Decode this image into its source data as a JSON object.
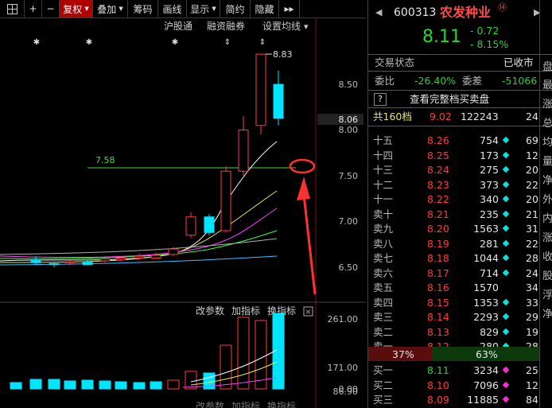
{
  "toolbar": {
    "items": [
      {
        "label": "",
        "icon": "grid-icon"
      },
      {
        "label": "+",
        "icon": "plus-icon"
      },
      {
        "label": "−",
        "icon": "minus-icon"
      },
      {
        "label": "复权",
        "caret": true,
        "active": true
      },
      {
        "label": "叠加",
        "caret": true
      },
      {
        "label": "筹码"
      },
      {
        "label": "画线"
      },
      {
        "label": "显示",
        "caret": true
      },
      {
        "label": "简约"
      },
      {
        "label": "隐藏"
      },
      {
        "label": "▸▸"
      }
    ]
  },
  "main_chart": {
    "links": [
      "沪股通",
      "融资融券",
      "设置均线"
    ],
    "y_ticks": [
      "8.50",
      "8.06",
      "8.00",
      "7.50",
      "7.00",
      "6.50"
    ],
    "max_label": "8.83",
    "ref_line_label": "7.58",
    "annotation": "red-circle-and-arrow"
  },
  "volume_chart": {
    "links": [
      "改参数",
      "加指标",
      "换指标"
    ],
    "y_ticks": [
      "261.00",
      "171.00",
      "86.90",
      "0.00"
    ],
    "bottom_links": [
      "改参数",
      "加指标",
      "换指标"
    ]
  },
  "chart_data": {
    "type": "candlestick",
    "price_ticks": [
      8.5,
      8.0,
      7.5,
      7.0,
      6.5
    ],
    "current_price_marker": 8.06,
    "reference_line": 7.58,
    "max_price": 8.83,
    "volume_ticks": [
      261.0,
      171.0,
      86.9,
      0.0
    ]
  },
  "quote": {
    "code": "600313",
    "name": "农发种业",
    "badge": "⑭",
    "price": "8.11",
    "change": "- 0.72",
    "change_pct": "- 8.15%",
    "status_label": "交易状态",
    "status_value": "已收市",
    "ratio_label": "委比",
    "ratio_value": "-26.40%",
    "diff_label": "委差",
    "diff_value": "-51066",
    "full_button_icon": "?",
    "full_button_label": "查看完整档买卖盘",
    "levels_label": "共160档",
    "levels_price": "9.02",
    "levels_volume": "122243",
    "levels_count": "24",
    "ratio_bar_left": "37%",
    "ratio_bar_right": "63%",
    "right_tabs": [
      "盘",
      "最",
      "涨",
      "总",
      "均",
      "量",
      "净",
      "外",
      "内",
      "涨",
      "收",
      "股",
      "浮",
      "净"
    ]
  },
  "asks": [
    {
      "label": "卖十五",
      "short": "十五",
      "price": "8.26",
      "vol": "754",
      "cnt": "69",
      "dot": "#00e5e5"
    },
    {
      "label": "卖十四",
      "short": "十四",
      "price": "8.25",
      "vol": "173",
      "cnt": "12",
      "dot": "#00e5e5"
    },
    {
      "label": "卖十三",
      "short": "十三",
      "price": "8.24",
      "vol": "275",
      "cnt": "20",
      "dot": "#00e5e5"
    },
    {
      "label": "卖十二",
      "short": "十二",
      "price": "8.23",
      "vol": "373",
      "cnt": "22",
      "dot": "#00e5e5"
    },
    {
      "label": "卖十一",
      "short": "十一",
      "price": "8.22",
      "vol": "340",
      "cnt": "20",
      "dot": "#00e5e5"
    },
    {
      "label": "卖十",
      "short": "卖十",
      "price": "8.21",
      "vol": "235",
      "cnt": "21",
      "dot": "#00e5e5"
    },
    {
      "label": "卖九",
      "short": "卖九",
      "price": "8.20",
      "vol": "1563",
      "cnt": "31",
      "dot": "#00e5e5"
    },
    {
      "label": "卖八",
      "short": "卖八",
      "price": "8.19",
      "vol": "281",
      "cnt": "22",
      "dot": "#00e5e5"
    },
    {
      "label": "卖七",
      "short": "卖七",
      "price": "8.18",
      "vol": "1044",
      "cnt": "28",
      "dot": "#00e5e5"
    },
    {
      "label": "卖六",
      "short": "卖六",
      "price": "8.17",
      "vol": "714",
      "cnt": "24",
      "dot": "#00e5e5"
    },
    {
      "label": "卖五",
      "short": "卖五",
      "price": "8.16",
      "vol": "1570",
      "cnt": "34",
      "dot": ""
    },
    {
      "label": "卖四",
      "short": "卖四",
      "price": "8.15",
      "vol": "1353",
      "cnt": "33",
      "dot": "#00e5e5"
    },
    {
      "label": "卖三",
      "short": "卖三",
      "price": "8.14",
      "vol": "2293",
      "cnt": "29",
      "dot": "#00e5e5"
    },
    {
      "label": "卖二",
      "short": "卖二",
      "price": "8.13",
      "vol": "829",
      "cnt": "19",
      "dot": "#00e5e5"
    },
    {
      "label": "卖一",
      "short": "卖一",
      "price": "8.12",
      "vol": "280",
      "cnt": "28",
      "dot": "#00e5e5"
    }
  ],
  "bids": [
    {
      "short": "买一",
      "price": "8.11",
      "vol": "3234",
      "cnt": "25",
      "dot": "#ff2bd6"
    },
    {
      "short": "买二",
      "price": "8.10",
      "vol": "7096",
      "cnt": "12",
      "dot": "#ff2bd6"
    },
    {
      "short": "买三",
      "price": "8.09",
      "vol": "11885",
      "cnt": "84",
      "dot": "#ff2bd6"
    }
  ]
}
